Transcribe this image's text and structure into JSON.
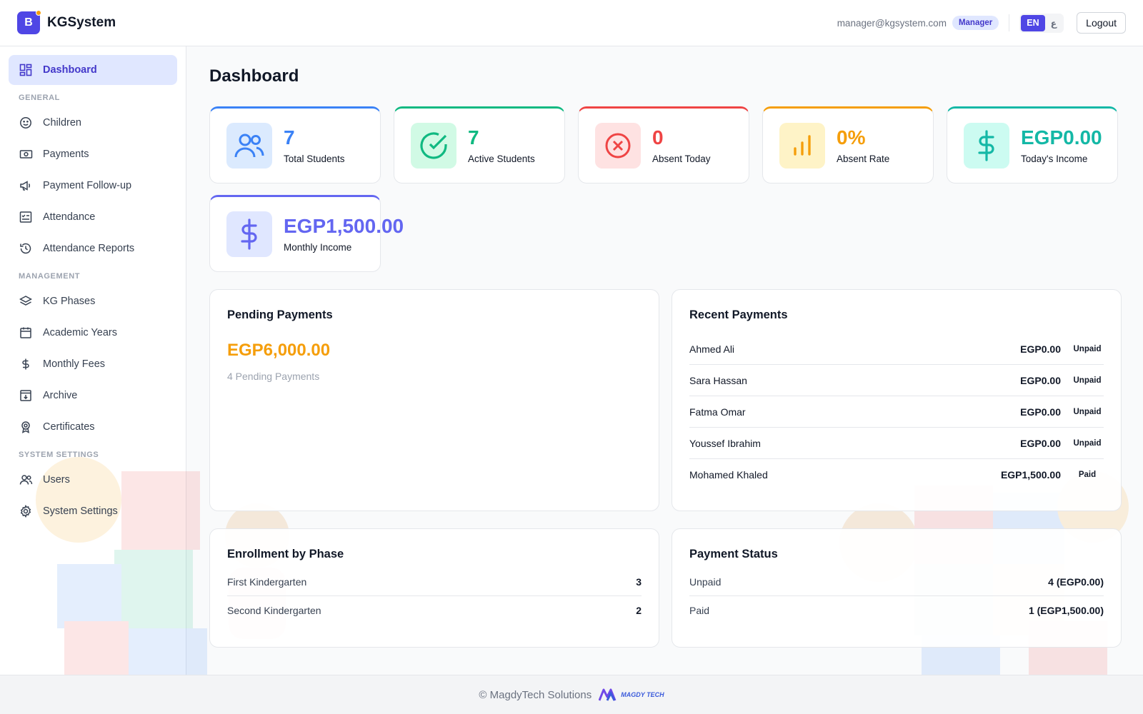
{
  "header": {
    "brand_letter": "B",
    "brand_name": "KGSystem",
    "user_email": "manager@kgsystem.com",
    "role": "Manager",
    "lang_en": "EN",
    "lang_ar": "ع",
    "logout": "Logout"
  },
  "sidebar": {
    "dashboard": "Dashboard",
    "sections": [
      {
        "title": "GENERAL",
        "items": [
          {
            "label": "Children",
            "icon": "smile-icon"
          },
          {
            "label": "Payments",
            "icon": "cash-icon"
          },
          {
            "label": "Payment Follow-up",
            "icon": "megaphone-icon"
          },
          {
            "label": "Attendance",
            "icon": "checklist-icon"
          },
          {
            "label": "Attendance Reports",
            "icon": "history-icon"
          }
        ]
      },
      {
        "title": "MANAGEMENT",
        "items": [
          {
            "label": "KG Phases",
            "icon": "layers-icon"
          },
          {
            "label": "Academic Years",
            "icon": "calendar-icon"
          },
          {
            "label": "Monthly Fees",
            "icon": "dollar-icon"
          },
          {
            "label": "Archive",
            "icon": "archive-icon"
          },
          {
            "label": "Certificates",
            "icon": "award-icon"
          }
        ]
      },
      {
        "title": "SYSTEM SETTINGS",
        "items": [
          {
            "label": "Users",
            "icon": "users-icon"
          },
          {
            "label": "System Settings",
            "icon": "gear-icon"
          }
        ]
      }
    ]
  },
  "main": {
    "title": "Dashboard",
    "stats": [
      {
        "value": "7",
        "label": "Total Students",
        "color": "#3b82f6",
        "bg": "#dbeafe",
        "icon": "users-icon"
      },
      {
        "value": "7",
        "label": "Active Students",
        "color": "#10b981",
        "bg": "#d1fae5",
        "icon": "check-circle-icon"
      },
      {
        "value": "0",
        "label": "Absent Today",
        "color": "#ef4444",
        "bg": "#fee2e2",
        "icon": "x-circle-icon"
      },
      {
        "value": "0%",
        "label": "Absent Rate",
        "color": "#f59e0b",
        "bg": "#fef3c7",
        "icon": "bar-chart-icon"
      },
      {
        "value": "EGP0.00",
        "label": "Today's Income",
        "color": "#14b8a6",
        "bg": "#ccfbf1",
        "icon": "dollar-icon"
      },
      {
        "value": "EGP1,500.00",
        "label": "Monthly Income",
        "color": "#6366f1",
        "bg": "#e0e7ff",
        "icon": "dollar-icon"
      }
    ],
    "pending": {
      "title": "Pending Payments",
      "amount": "EGP6,000.00",
      "count_text": "4 Pending Payments"
    },
    "recent": {
      "title": "Recent Payments",
      "rows": [
        {
          "name": "Ahmed Ali",
          "amount": "EGP0.00",
          "status": "Unpaid"
        },
        {
          "name": "Sara Hassan",
          "amount": "EGP0.00",
          "status": "Unpaid"
        },
        {
          "name": "Fatma Omar",
          "amount": "EGP0.00",
          "status": "Unpaid"
        },
        {
          "name": "Youssef Ibrahim",
          "amount": "EGP0.00",
          "status": "Unpaid"
        },
        {
          "name": "Mohamed Khaled",
          "amount": "EGP1,500.00",
          "status": "Paid"
        }
      ]
    },
    "enrollment": {
      "title": "Enrollment by Phase",
      "rows": [
        {
          "label": "First Kindergarten",
          "value": "3"
        },
        {
          "label": "Second Kindergarten",
          "value": "2"
        }
      ]
    },
    "payment_status": {
      "title": "Payment Status",
      "rows": [
        {
          "label": "Unpaid",
          "value": "4 (EGP0.00)"
        },
        {
          "label": "Paid",
          "value": "1 (EGP1,500.00)"
        }
      ]
    }
  },
  "footer": {
    "copyright": "© MagdyTech Solutions",
    "logo_text": "MAGDY TECH"
  }
}
